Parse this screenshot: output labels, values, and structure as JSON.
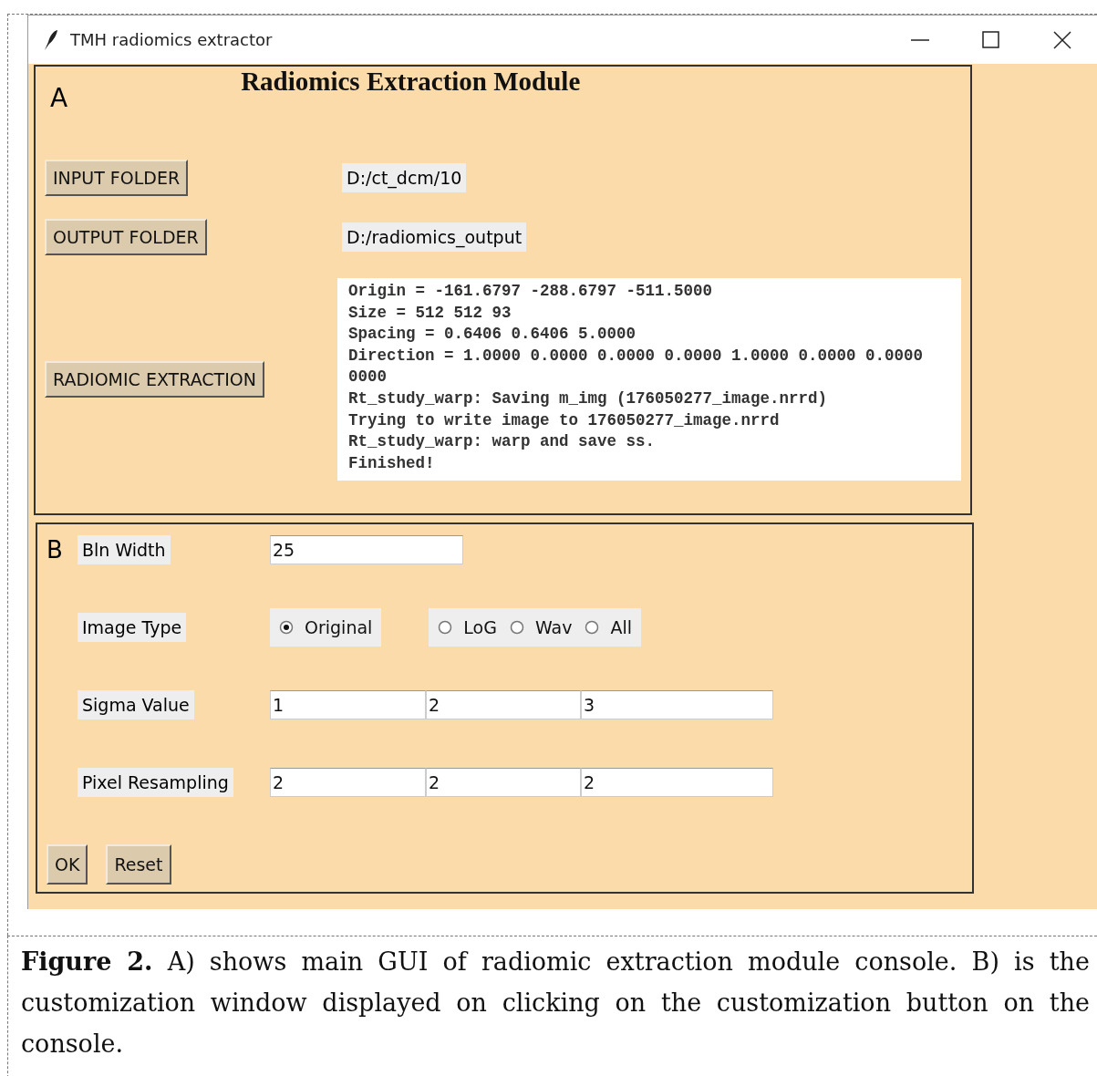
{
  "window": {
    "title": "TMH radiomics extractor"
  },
  "panel_a": {
    "label": "A",
    "title": "Radiomics Extraction Module",
    "folders": [
      {
        "button": "INPUT FOLDER",
        "value": "D:/ct_dcm/10"
      },
      {
        "button": "OUTPUT FOLDER",
        "value": "D:/radiomics_output"
      }
    ],
    "extract_button": "RADIOMIC EXTRACTION",
    "log": [
      "Origin = -161.6797 -288.6797 -511.5000",
      "Size = 512 512 93",
      "Spacing = 0.6406 0.6406 5.0000",
      "Direction = 1.0000 0.0000 0.0000 0.0000 1.0000 0.0000 0.0000",
      "0000",
      "Rt_study_warp: Saving m_img (176050277_image.nrrd)",
      "Trying to write image to 176050277_image.nrrd",
      "Rt_study_warp: warp and save ss.",
      "Finished!"
    ]
  },
  "panel_b": {
    "label": "B",
    "bin_width": {
      "label": "Bln Width",
      "value": "25"
    },
    "image_type": {
      "label": "Image Type",
      "option_groups": [
        [
          {
            "label": "Original",
            "selected": true
          }
        ],
        [
          {
            "label": "LoG",
            "selected": false
          },
          {
            "label": "Wav",
            "selected": false
          },
          {
            "label": "All",
            "selected": false
          }
        ]
      ]
    },
    "sigma": {
      "label": "Sigma Value",
      "values": [
        "1",
        "2",
        "3"
      ]
    },
    "resampling": {
      "label": "Pixel Resampling",
      "values": [
        "2",
        "2",
        "2"
      ]
    },
    "buttons": [
      "OK",
      "Reset"
    ]
  },
  "caption": "**Figure 2.** A) shows main GUI of radiomic extraction module console. B) is the customization window displayed on clicking on the customization button on the console."
}
